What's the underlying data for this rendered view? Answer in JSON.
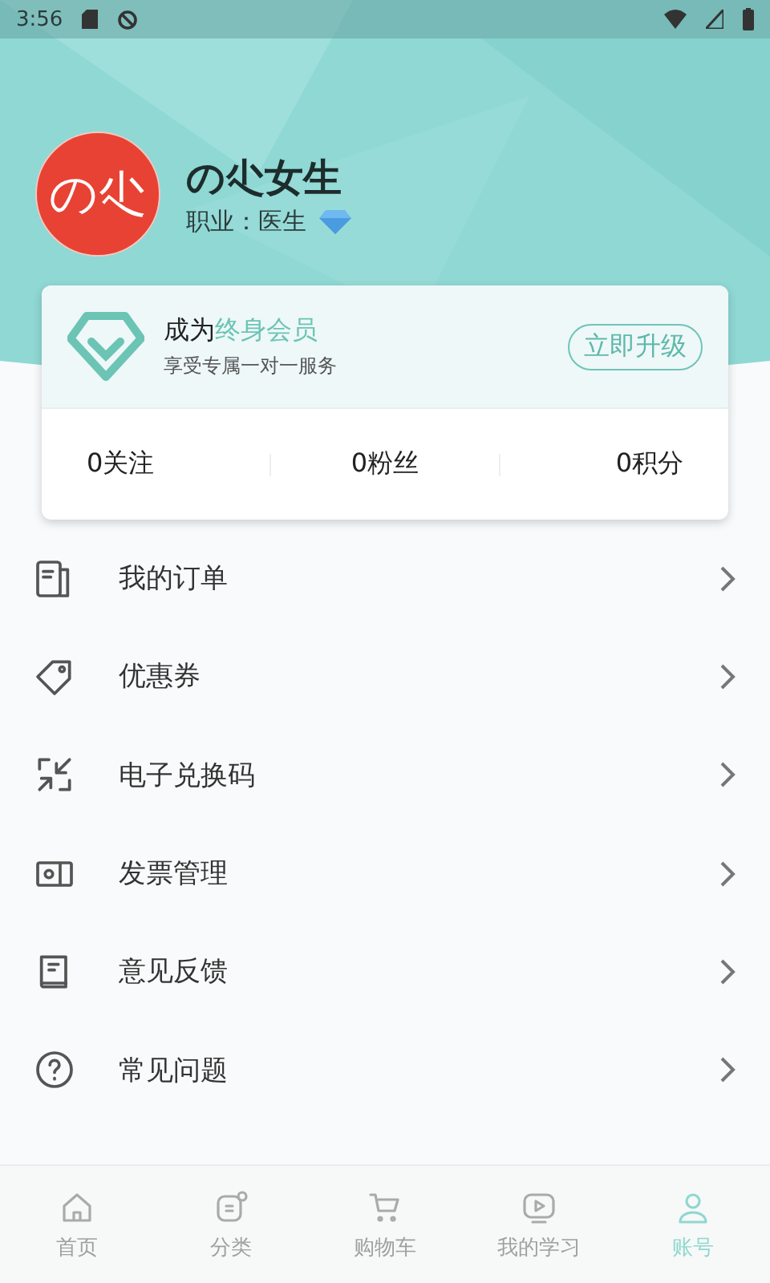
{
  "status_bar": {
    "time": "3:56"
  },
  "profile": {
    "avatar_text": "の尐",
    "name": "の尐女生",
    "occupation": "职业：医生"
  },
  "membership": {
    "title_plain": "成为",
    "title_highlight": "终身会员",
    "subtitle": "享受专属一对一服务",
    "button": "立即升级"
  },
  "stats": [
    "0关注",
    "0粉丝",
    "0积分"
  ],
  "menu": [
    {
      "label": "我的订单"
    },
    {
      "label": "优惠券"
    },
    {
      "label": "电子兑换码"
    },
    {
      "label": "发票管理"
    },
    {
      "label": "意见反馈"
    },
    {
      "label": "常见问题"
    }
  ],
  "tabs": [
    {
      "label": "首页",
      "selected": false
    },
    {
      "label": "分类",
      "selected": false
    },
    {
      "label": "购物车",
      "selected": false
    },
    {
      "label": "我的学习",
      "selected": false
    },
    {
      "label": "账号",
      "selected": true
    }
  ]
}
